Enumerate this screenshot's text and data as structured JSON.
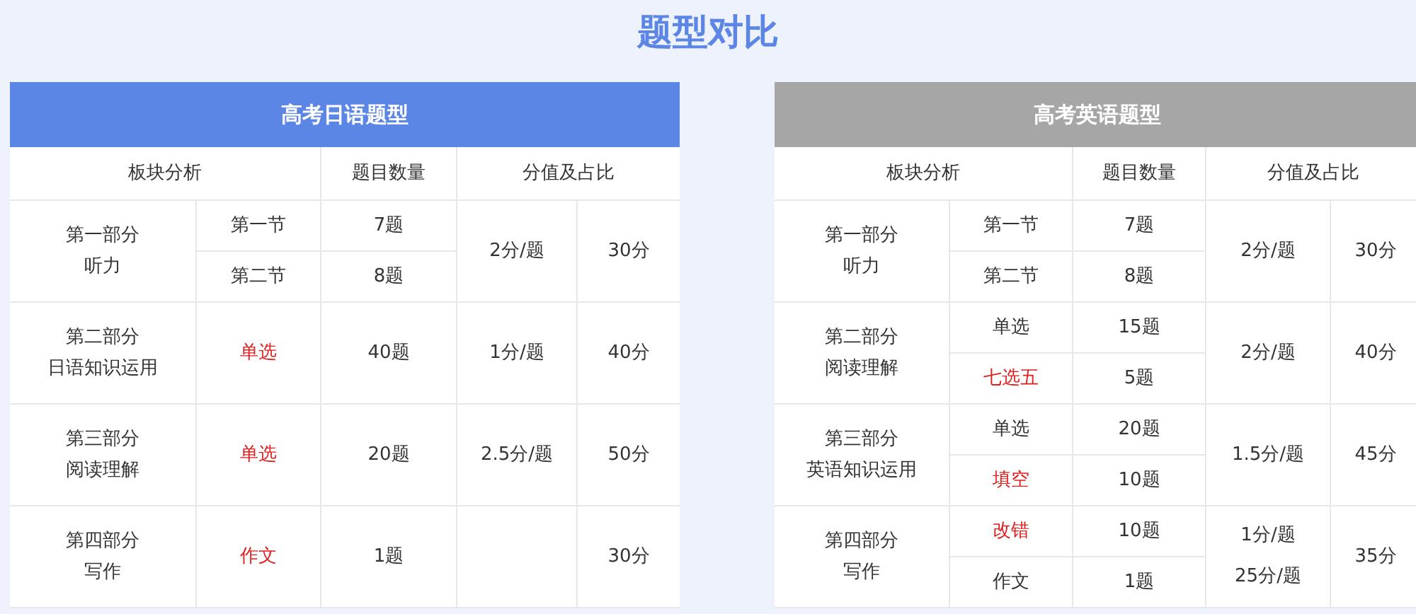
{
  "title": "题型对比",
  "tables": [
    {
      "title": "高考日语题型",
      "color": "#5b86e5",
      "columns": [
        "板块分析",
        "题目数量",
        "分值及占比"
      ],
      "sections": [
        {
          "part": "第一部分",
          "name": "听力",
          "rows": [
            {
              "type": "第一节",
              "emphasized": false,
              "count": "7题"
            },
            {
              "type": "第二节",
              "emphasized": false,
              "count": "8题"
            }
          ],
          "score": "2分/题",
          "total": "30分"
        },
        {
          "part": "第二部分",
          "name": "日语知识运用",
          "rows": [
            {
              "type": "单选",
              "emphasized": true,
              "count": "40题"
            }
          ],
          "score": "1分/题",
          "total": "40分"
        },
        {
          "part": "第三部分",
          "name": "阅读理解",
          "rows": [
            {
              "type": "单选",
              "emphasized": true,
              "count": "20题"
            }
          ],
          "score": "2.5分/题",
          "total": "50分"
        },
        {
          "part": "第四部分",
          "name": "写作",
          "rows": [
            {
              "type": "作文",
              "emphasized": true,
              "count": "1题"
            }
          ],
          "total": "30分"
        }
      ]
    },
    {
      "title": "高考英语题型",
      "color": "#a6a6a6",
      "columns": [
        "板块分析",
        "题目数量",
        "分值及占比"
      ],
      "sections": [
        {
          "part": "第一部分",
          "name": "听力",
          "rows": [
            {
              "type": "第一节",
              "emphasized": false,
              "count": "7题"
            },
            {
              "type": "第二节",
              "emphasized": false,
              "count": "8题"
            }
          ],
          "score": "2分/题",
          "total": "30分"
        },
        {
          "part": "第二部分",
          "name": "阅读理解",
          "rows": [
            {
              "type": "单选",
              "emphasized": false,
              "count": "15题"
            },
            {
              "type": "七选五",
              "emphasized": true,
              "count": "5题"
            }
          ],
          "score": "2分/题",
          "total": "40分"
        },
        {
          "part": "第三部分",
          "name": "英语知识运用",
          "rows": [
            {
              "type": "单选",
              "emphasized": false,
              "count": "20题"
            },
            {
              "type": "填空",
              "emphasized": true,
              "count": "10题"
            }
          ],
          "score": "1.5分/题",
          "total": "45分"
        },
        {
          "part": "第四部分",
          "name": "写作",
          "rows": [
            {
              "type": "改错",
              "emphasized": true,
              "count": "10题",
              "score": "1分/题"
            },
            {
              "type": "作文",
              "emphasized": false,
              "count": "1题",
              "score": "25分/题"
            }
          ],
          "total": "35分"
        }
      ]
    }
  ]
}
